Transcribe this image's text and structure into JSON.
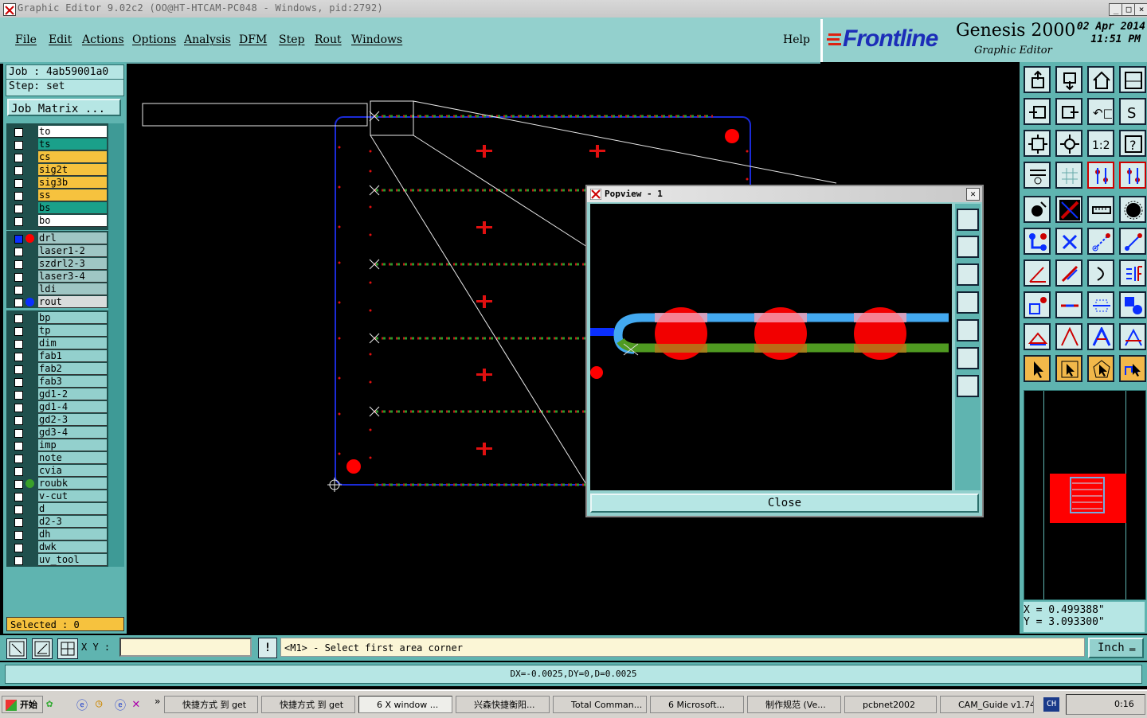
{
  "window": {
    "title": "Graphic Editor 9.02c2 (OO@HT-HTCAM-PC048 - Windows, pid:2792)",
    "min": "_",
    "max": "□",
    "close": "×"
  },
  "menu": [
    "File",
    "Edit",
    "Actions",
    "Options",
    "Analysis",
    "DFM",
    "Step",
    "Rout",
    "Windows"
  ],
  "help": "Help",
  "banner": {
    "brand": "Frontline",
    "product": "Genesis 2000",
    "subtitle": "Graphic Editor",
    "date": "02 Apr 2014",
    "time": "11:51 PM"
  },
  "job": {
    "job_label": "Job : 4ab59001a0",
    "step_label": "Step: set",
    "matrix_button": "Job Matrix ..."
  },
  "layers": {
    "board": [
      {
        "name": "to",
        "color": "#ffffff"
      },
      {
        "name": "ts",
        "color": "#1aa08a"
      },
      {
        "name": "cs",
        "color": "#f6c23e"
      },
      {
        "name": "sig2t",
        "color": "#f6c23e"
      },
      {
        "name": "sig3b",
        "color": "#f6c23e"
      },
      {
        "name": "ss",
        "color": "#f6c23e"
      },
      {
        "name": "bs",
        "color": "#1aa08a"
      },
      {
        "name": "bo",
        "color": "#ffffff"
      }
    ],
    "drill": [
      {
        "name": "drl",
        "color": "#9fc6c4",
        "dot": "#ff0000",
        "active": true
      },
      {
        "name": "laser1-2",
        "color": "#9fc6c4"
      },
      {
        "name": "szdrl2-3",
        "color": "#9fc6c4"
      },
      {
        "name": "laser3-4",
        "color": "#9fc6c4"
      },
      {
        "name": "ldi",
        "color": "#9fc6c4"
      },
      {
        "name": "rout",
        "color": "#d9dcdc",
        "dot": "#0a2fff"
      }
    ],
    "misc": [
      {
        "name": "bp"
      },
      {
        "name": "tp"
      },
      {
        "name": "dim"
      },
      {
        "name": "fab1"
      },
      {
        "name": "fab2"
      },
      {
        "name": "fab3"
      },
      {
        "name": "gd1-2"
      },
      {
        "name": "gd1-4"
      },
      {
        "name": "gd2-3"
      },
      {
        "name": "gd3-4"
      },
      {
        "name": "imp"
      },
      {
        "name": "note"
      },
      {
        "name": "cvia"
      },
      {
        "name": "roubk",
        "dot": "#3aa02a"
      },
      {
        "name": "v-cut"
      },
      {
        "name": "d"
      },
      {
        "name": "d2-3"
      },
      {
        "name": "dh"
      },
      {
        "name": "dwk"
      },
      {
        "name": "uv_tool"
      }
    ]
  },
  "selected": "Selected : 0",
  "popview": {
    "title": "Popview - 1",
    "close_button": "Close"
  },
  "coords": {
    "x": "X = 0.499388\"",
    "y": "Y = 3.093300\""
  },
  "command": {
    "xy_label": "X Y :",
    "xy_value": "",
    "prompt": "<M1> - Select first area corner",
    "units": "Inch"
  },
  "status": "DX=-0.0025,DY=0,D=0.0025",
  "taskbar": {
    "start": "开始",
    "items": [
      "快捷方式 到 get",
      "快捷方式 到 get",
      "6 X window ...",
      "兴森快捷衡阳...",
      "Total Comman...",
      "6 Microsoft...",
      "制作规范 (Ve...",
      "pcbnet2002",
      "CAM_Guide v1.74"
    ],
    "lang": "CH",
    "clock": "0:16"
  },
  "colors": {
    "teal": "#5fb4b0",
    "menu": "#93d0cd",
    "accent_red": "#ff0000",
    "route_blue": "#1b2bd8"
  }
}
